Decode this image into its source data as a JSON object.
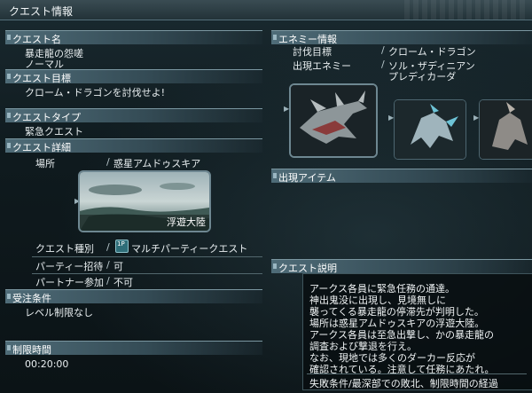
{
  "window": {
    "title": "クエスト情報"
  },
  "quest": {
    "name_header": "クエスト名",
    "name_line1": "暴走龍の怨嗟",
    "name_line2": "ノーマル",
    "goal_header": "クエスト目標",
    "goal": "クローム・ドラゴンを討伐せよ!",
    "type_header": "クエストタイプ",
    "type": "緊急クエスト",
    "detail_header": "クエスト詳細",
    "place_label": "場所",
    "place_value": "惑星アムドゥスキア",
    "area_caption": "浮遊大陸",
    "kind_label": "クエスト種別",
    "kind_value": "マルチパーティークエスト",
    "kind_badge": "1P",
    "party_label": "パーティー招待",
    "party_value": "可",
    "partner_label": "パートナー参加",
    "partner_value": "不可",
    "cond_header": "受注条件",
    "cond": "レベル制限なし",
    "time_header": "制限時間",
    "time": "00:20:00"
  },
  "enemy": {
    "header": "エネミー情報",
    "target_label": "討伐目標",
    "target_value": "クローム・ドラゴン",
    "appear_label": "出現エネミー",
    "appear_line1": "ソル・ザディニアン",
    "appear_line2": "プレディカーダ"
  },
  "items": {
    "header": "出現アイテム"
  },
  "description": {
    "header": "クエスト説明",
    "lines": [
      "アークス各員に緊急任務の通達。",
      "神出鬼没に出現し、見境無しに",
      "襲ってくる暴走龍の停滞先が判明した。",
      "場所は惑星アムドゥスキアの浮遊大陸。",
      "アークス各員は至急出撃し、かの暴走龍の",
      "調査および撃退を行え。",
      "なお、現地では多くのダーカー反応が",
      "確認されている。注意して任務にあたれ。"
    ],
    "fail": "失敗条件/最深部での敗北、制限時間の経過"
  },
  "colors": {
    "header": "#4f6c78",
    "background": "#0f1a1e",
    "text": "#e8eef0"
  }
}
